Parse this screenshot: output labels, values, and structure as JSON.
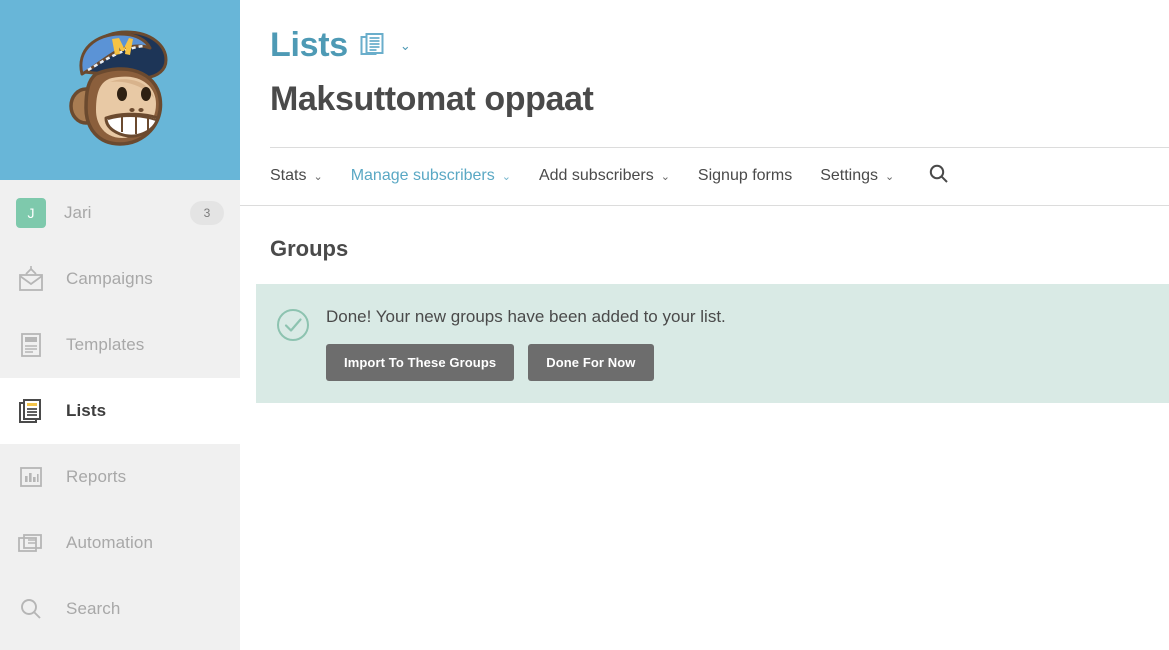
{
  "sidebar": {
    "logo": {
      "name": "mailchimp-freddie-logo",
      "bg": "#68b6d8"
    },
    "account": {
      "avatar_initial": "J",
      "name": "Jari",
      "badge": "3",
      "avatar_color": "#7ec9ac"
    },
    "items": [
      {
        "label": "Campaigns",
        "icon": "envelope-icon",
        "active": false
      },
      {
        "label": "Templates",
        "icon": "template-icon",
        "active": false
      },
      {
        "label": "Lists",
        "icon": "lists-icon",
        "active": true
      },
      {
        "label": "Reports",
        "icon": "bar-chart-icon",
        "active": false
      },
      {
        "label": "Automation",
        "icon": "automation-icon",
        "active": false
      },
      {
        "label": "Search",
        "icon": "search-icon",
        "active": false
      }
    ]
  },
  "header": {
    "kicker": "Lists",
    "kicker_icon": "lists-document-icon",
    "kicker_caret": "⌄",
    "title": "Maksuttomat oppaat",
    "accent_color": "#4e9ab5"
  },
  "tabs": [
    {
      "label": "Stats",
      "caret": "⌄",
      "active": false
    },
    {
      "label": "Manage subscribers",
      "caret": "⌄",
      "active": true
    },
    {
      "label": "Add subscribers",
      "caret": "⌄",
      "active": false
    },
    {
      "label": "Signup forms",
      "caret": "",
      "active": false
    },
    {
      "label": "Settings",
      "caret": "⌄",
      "active": false
    }
  ],
  "tab_search_icon": "search-icon",
  "content": {
    "section_title": "Groups",
    "alert": {
      "icon": "check-circle-icon",
      "message": "Done! Your new groups have been added to your list.",
      "bg_color": "#d9eae5",
      "icon_color": "#8dc3b0",
      "primary_button": "Import To These Groups",
      "secondary_button": "Done For Now",
      "button_color": "#6d6d6d"
    }
  }
}
